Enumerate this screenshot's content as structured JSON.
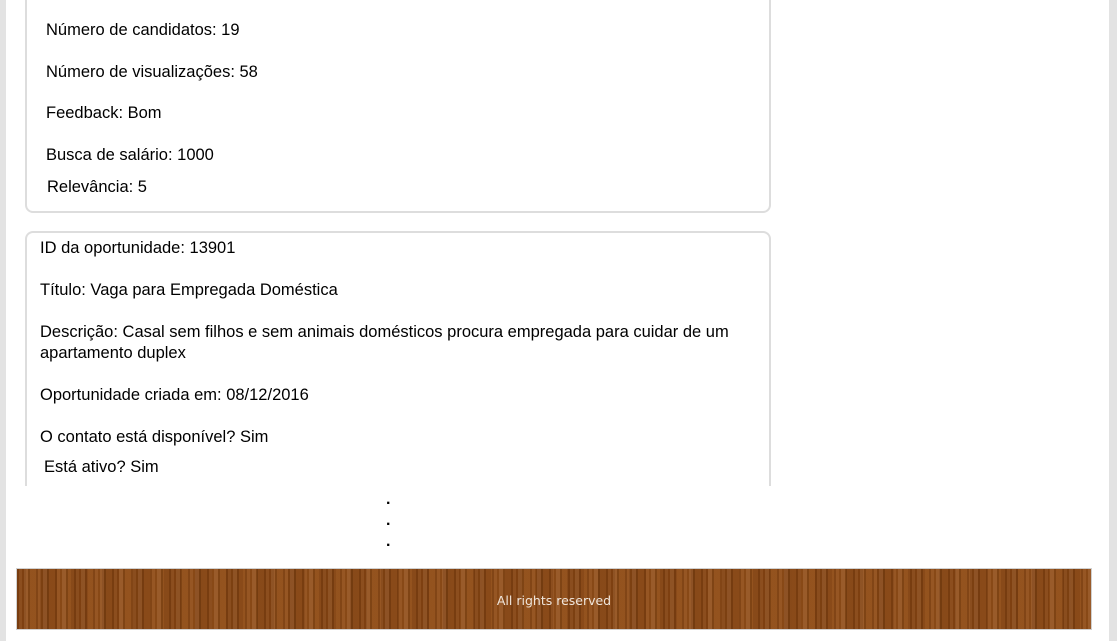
{
  "opportunity_1": {
    "candidates": "Número de candidatos: 19",
    "views": "Número de visualizações: 58",
    "feedback": "Feedback: Bom",
    "salary": "Busca de salário: 1000",
    "relevance": "Relevância: 5"
  },
  "opportunity_2": {
    "id": "ID da oportunidade: 13901",
    "title": "Título: Vaga para Empregada Doméstica",
    "description": "Descrição: Casal sem filhos e sem animais domésticos procura empregada para cuidar de um apartamento duplex",
    "created": "Oportunidade criada em: 08/12/2016",
    "contact_available": "O contato está disponível? Sim",
    "active": "Está ativo? Sim"
  },
  "continuation_dots": [
    ".",
    ".",
    "."
  ],
  "footer": {
    "text": "All rights reserved"
  }
}
